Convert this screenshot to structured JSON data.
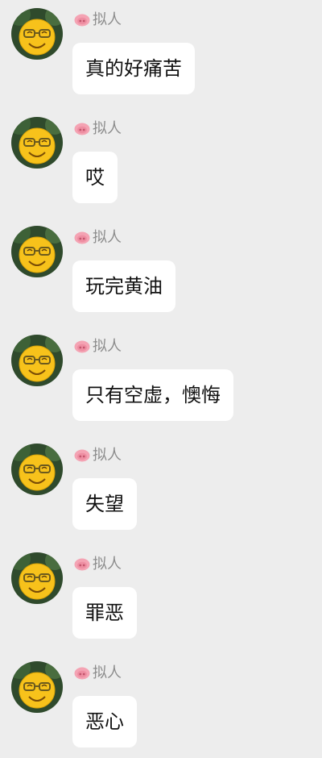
{
  "messages": [
    {
      "sender": "拟人",
      "text": "真的好痛苦"
    },
    {
      "sender": "拟人",
      "text": "哎"
    },
    {
      "sender": "拟人",
      "text": "玩完黄油"
    },
    {
      "sender": "拟人",
      "text": "只有空虚，懊悔"
    },
    {
      "sender": "拟人",
      "text": "失望"
    },
    {
      "sender": "拟人",
      "text": "罪恶"
    },
    {
      "sender": "拟人",
      "text": "恶心"
    }
  ],
  "colors": {
    "background": "#ededed",
    "bubble": "#ffffff",
    "sender_text": "#8c8c8c",
    "pig_icon": "#f4a3b3",
    "avatar_face": "#f7c21b"
  },
  "icons": {
    "sender_badge": "pig-nose-icon",
    "avatar": "smiley-glasses-avatar"
  }
}
